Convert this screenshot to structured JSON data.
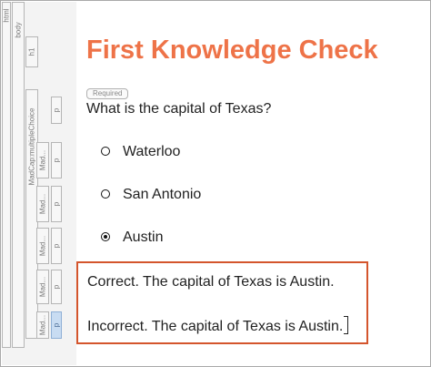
{
  "structure_tags": {
    "html": "html",
    "body": "body",
    "h1": "h1",
    "multiple_choice": "MadCap:multipleChoice",
    "mad": "Mad...",
    "p": "p"
  },
  "title": "First Knowledge Check",
  "required_label": "Required",
  "question": "What is the capital of Texas?",
  "choices": [
    {
      "label": "Waterloo",
      "selected": false
    },
    {
      "label": "San Antonio",
      "selected": false
    },
    {
      "label": "Austin",
      "selected": true
    }
  ],
  "feedback": {
    "correct": "Correct. The capital of Texas is Austin.",
    "incorrect": "Incorrect. The capital of Texas is Austin."
  },
  "colors": {
    "title": "#ee7348",
    "feedback_border": "#d4552d",
    "selected_tag": "#c8dcf2"
  }
}
